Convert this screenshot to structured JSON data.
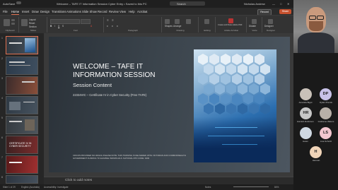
{
  "window": {
    "autosave": "AutoSave",
    "title": "Welcome – TAFE IT Information Session Cyber Entry • Saved to this PC",
    "search": "Search",
    "user": "Nicholas Andrew"
  },
  "tabs": [
    "File",
    "Home",
    "Insert",
    "Draw",
    "Design",
    "Transitions",
    "Animations",
    "Slide Show",
    "Record",
    "Review",
    "View",
    "Help",
    "Acrobat"
  ],
  "actions": {
    "record": "Record",
    "share": "Share"
  },
  "ribbon": {
    "groups": [
      "Clipboard",
      "Slides",
      "Font",
      "Paragraph",
      "Drawing",
      "Editing",
      "Adobe Acrobat",
      "Voice",
      "Designer"
    ],
    "slide_items": [
      "Layout",
      "Reset",
      "Section"
    ],
    "buttons": [
      "New Slide",
      "Shapes",
      "Arrange",
      "Quick Styles",
      "Dictate",
      "Designer",
      "Create and Share Adobe PDF"
    ]
  },
  "thumbnails": [
    {
      "num": "1",
      "label": ""
    },
    {
      "num": "2",
      "label": ""
    },
    {
      "num": "3",
      "label": ""
    },
    {
      "num": "4",
      "label": ""
    },
    {
      "num": "5",
      "label": ""
    },
    {
      "num": "6",
      "label": "CERTIFICATE IV IN CYBER SECURITY"
    },
    {
      "num": "7",
      "label": ""
    },
    {
      "num": "8",
      "label": ""
    }
  ],
  "slide": {
    "title": "WELCOME – TAFE IT INFORMATION SESSION",
    "subtitle": "Session Content",
    "course": "22334VIC – Certificate IV in Cyber Security (Free TAFE)",
    "footer": "CRICOS PROVIDER NO.00012G PLEASE NOTE: THIS TRAINING IS DELIVERED WITH VICTORIAN AND COMMONWEALTH GOVERNMENT FUNDING TO ELIGIBLE INDIVIDUALS. NATIONAL RTO CODE: 4909"
  },
  "notes": {
    "placeholder": "Click to add notes"
  },
  "status": {
    "slide": "Slide 1 of 29",
    "language": "English (Australia)",
    "accessibility": "Accessibility: Investigate",
    "notes": "Notes",
    "zoom": "84%"
  },
  "participants": [
    {
      "initials": "",
      "name": "Amanda Bigot",
      "color": "#c9c1b8"
    },
    {
      "initials": "DP",
      "name": "Dylan Prentis",
      "color": "#c8c2e8"
    },
    {
      "initials": "HR",
      "name": "Hamish Robinson",
      "color": "#c7c7c7"
    },
    {
      "initials": "",
      "name": "Grahame Waters",
      "color": "#b8b0a8"
    },
    {
      "initials": "",
      "name": "Helen",
      "color": "#cfd8e2"
    },
    {
      "initials": "LS",
      "name": "Lisa Schultz",
      "color": "#f2c6cf"
    },
    {
      "initials": "H",
      "name": "Hannah",
      "color": "#f0d4b8"
    }
  ]
}
